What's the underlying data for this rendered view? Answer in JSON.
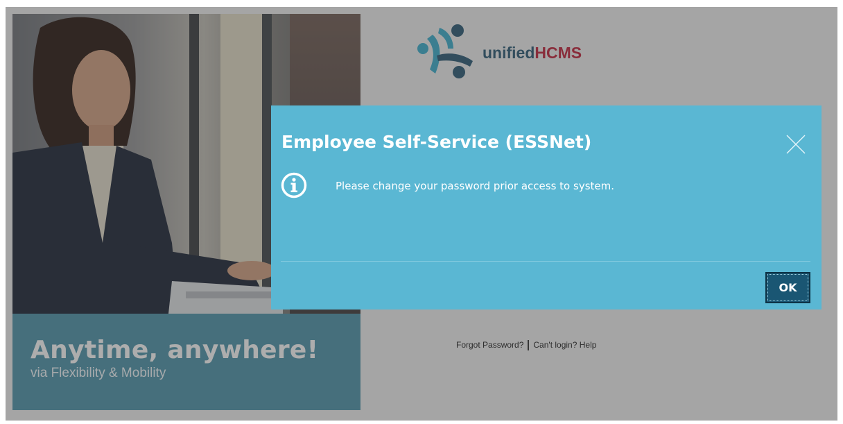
{
  "brand": {
    "name_part1": "unified",
    "name_part2": "HCMS",
    "color_dark": "#2c5871",
    "color_red": "#b8253a"
  },
  "hero": {
    "headline": "Anytime, anywhere!",
    "subline": "via Flexibility & Mobility",
    "caption_bg": "#4d8fa3"
  },
  "login_links": {
    "forgot_password": "Forgot Password?",
    "cant_login": "Can't login? Help"
  },
  "dialog": {
    "title": "Employee Self-Service (ESSNet)",
    "message": "Please change your password prior access to system.",
    "ok_label": "OK",
    "close_icon": "close-icon",
    "info_icon": "info-icon",
    "bg_color": "#5ab7d3",
    "button_color": "#1a5673"
  }
}
